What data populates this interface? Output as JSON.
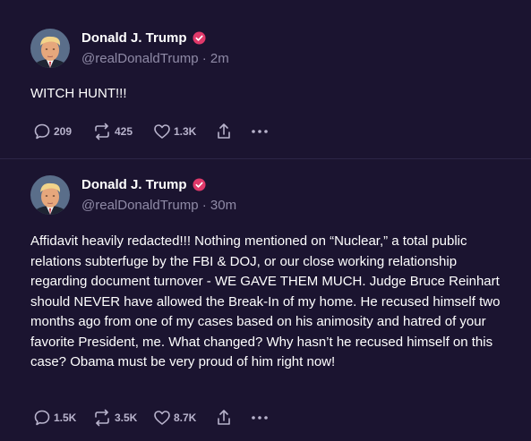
{
  "posts": [
    {
      "author_name": "Donald J. Trump",
      "handle": "@realDonaldTrump",
      "time": "2m",
      "text": "WITCH HUNT!!!",
      "replies": "209",
      "reposts": "425",
      "likes": "1.3K"
    },
    {
      "author_name": "Donald J. Trump",
      "handle": "@realDonaldTrump",
      "time": "30m",
      "text": "Affidavit heavily redacted!!! Nothing mentioned on “Nuclear,” a total public relations subterfuge by the FBI & DOJ, or our close working relationship regarding document turnover - WE GAVE THEM MUCH. Judge Bruce Reinhart should NEVER have allowed the Break-In of my home. He recused himself two months ago from one of my cases based on his animosity and hatred of your favorite President, me. What changed? Why hasn’t he recused himself on this case? Obama must be very proud of him right now!",
      "replies": "1.5K",
      "reposts": "3.5K",
      "likes": "8.7K"
    }
  ],
  "separator": "·",
  "icons": {
    "verified": "verified-badge-icon",
    "reply": "reply-bubble-icon",
    "repost": "repost-arrows-icon",
    "like": "heart-icon",
    "share": "share-upload-icon",
    "more": "more-dots-icon"
  },
  "colors": {
    "background": "#1b1430",
    "text": "#ffffff",
    "muted": "#8f8aa6",
    "action": "#b8b3cc",
    "verified": "#e0396a"
  }
}
